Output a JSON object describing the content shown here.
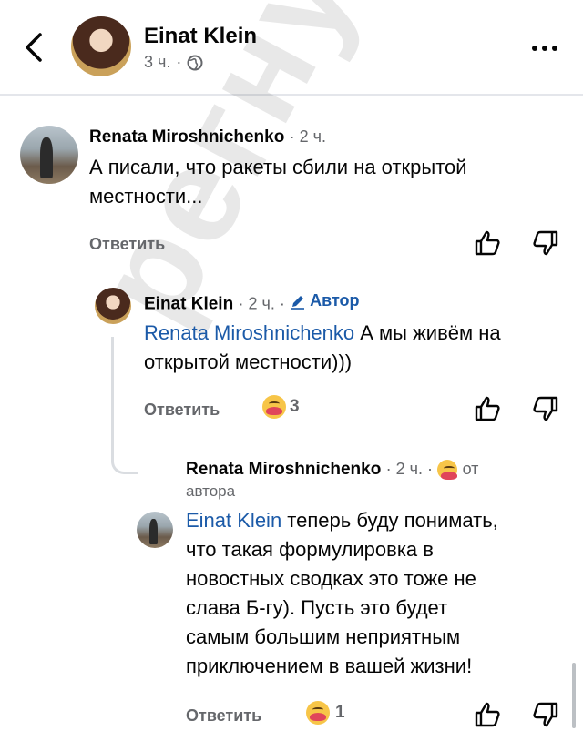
{
  "header": {
    "name": "Einat Klein",
    "time": "3 ч.",
    "separator": "·"
  },
  "comments": [
    {
      "author": "Renata Miroshnichenko",
      "time": "· 2 ч.",
      "text_line1": "А писали, что ракеты сбили на открытой",
      "text_line2": "местности...",
      "reply_label": "Ответить"
    },
    {
      "author": "Einat Klein",
      "time": "· 2 ч. ·",
      "badge": "Автор",
      "mention": "Renata Miroshnichenko",
      "text_line1_rest": " А мы живём на",
      "text_line2": "открытой местности)))",
      "reply_label": "Ответить",
      "reaction_count": "3"
    },
    {
      "author": "Renata Miroshnichenko",
      "time": "· 2 ч. ·",
      "from_label": "от",
      "from_label2": "автора",
      "mention": "Einat Klein",
      "text_line1_rest": " теперь буду понимать,",
      "text_line2": "что такая формулировка в",
      "text_line3": "новостных сводках это тоже не",
      "text_line4": "слава Б-гу). Пусть это будет",
      "text_line5": "самым большим неприятным",
      "text_line6": "приключением в вашей жизни!",
      "reply_label": "Ответить",
      "reaction_count": "1"
    }
  ],
  "watermark": "регнум",
  "icons": [
    "back-icon",
    "globe-icon",
    "more-icon",
    "like-icon",
    "dislike-icon",
    "pencil-icon",
    "care-emoji-icon"
  ],
  "colors": {
    "mention": "#1b5aa8",
    "meta": "#65676b"
  }
}
